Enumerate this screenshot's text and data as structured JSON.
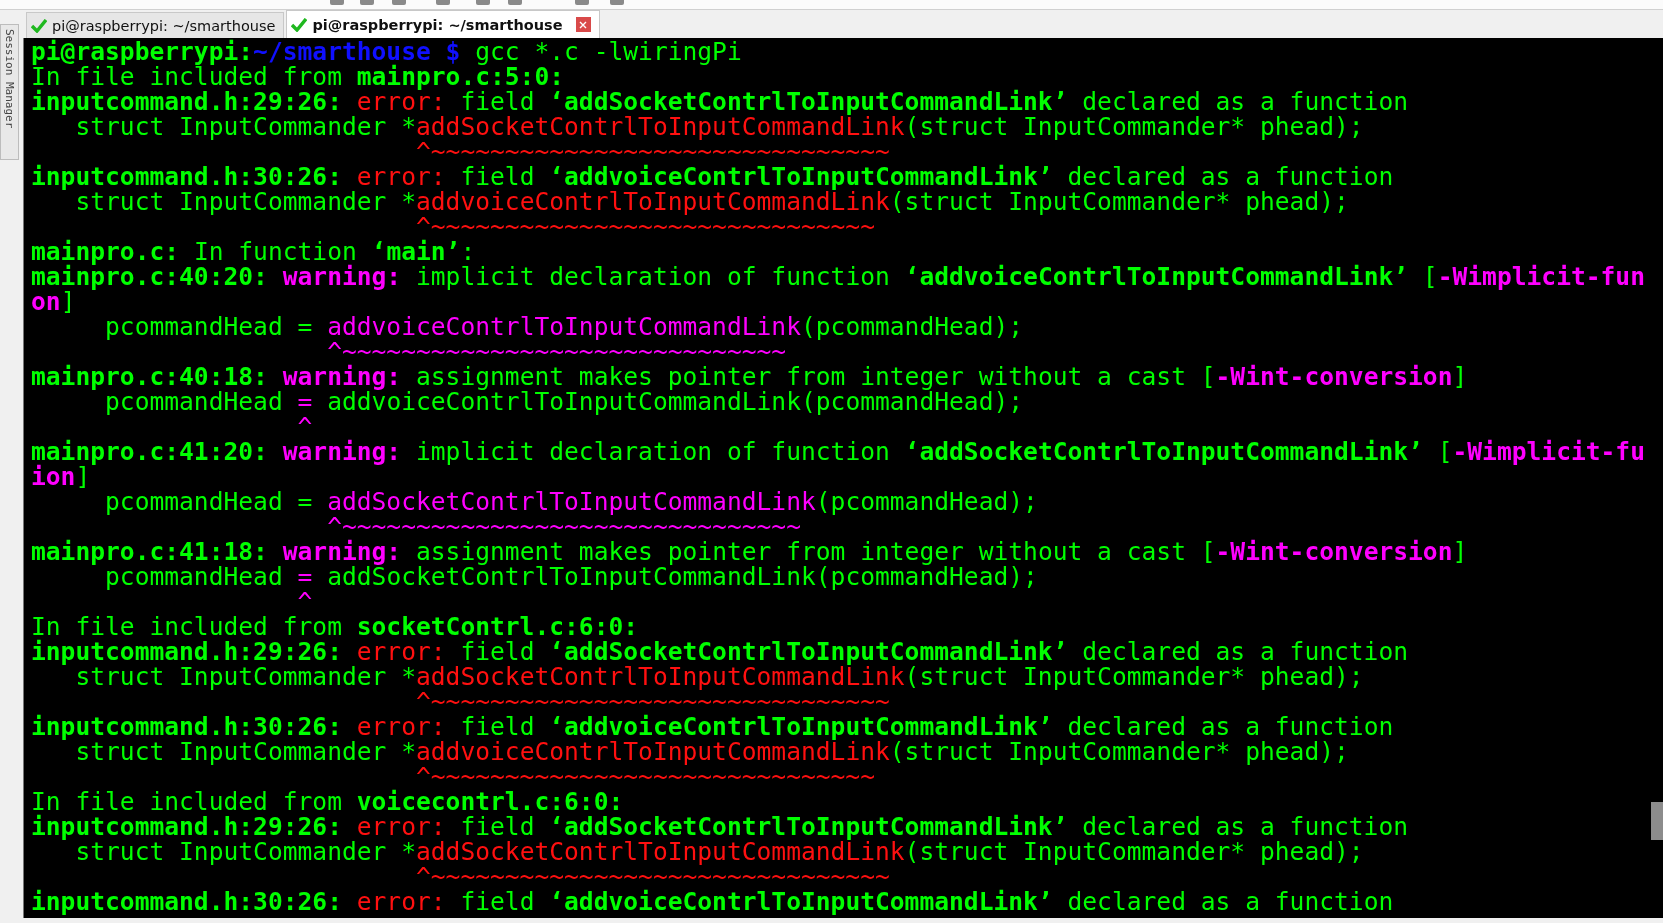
{
  "side_panel": {
    "label": "Session Manager"
  },
  "tabs": [
    {
      "label": "pi@raspberrypi: ~/smarthouse",
      "selected": false,
      "connected": true
    },
    {
      "label": "pi@raspberrypi: ~/smarthouse",
      "selected": true,
      "connected": true
    }
  ],
  "terminal": {
    "lines": [
      [
        {
          "kind": "prompt",
          "text": "pi@raspberrypi:"
        },
        {
          "kind": "path",
          "text": "~/smarthouse $"
        },
        {
          "kind": "plain",
          "text": " gcc *.c -lwiringPi"
        }
      ],
      [
        {
          "kind": "plain",
          "text": "In file included from "
        },
        {
          "kind": "bold",
          "text": "mainpro.c:5:0:"
        }
      ],
      [
        {
          "kind": "bold",
          "text": "inputcommand.h:29:26: "
        },
        {
          "kind": "error",
          "text": "error:"
        },
        {
          "kind": "plain",
          "text": " field "
        },
        {
          "kind": "bold",
          "text": "‘addSocketContrlToInputCommandLink’"
        },
        {
          "kind": "plain",
          "text": " declared as a function"
        }
      ],
      [
        {
          "kind": "plain",
          "text": "   struct InputCommander *"
        },
        {
          "kind": "error",
          "text": "addSocketContrlToInputCommandLink"
        },
        {
          "kind": "plain",
          "text": "(struct InputCommander* phead);"
        }
      ],
      [
        {
          "kind": "error",
          "text": "                          ^~~~~~~~~~~~~~~~~~~~~~~~~~~~~~~~"
        }
      ],
      [
        {
          "kind": "bold",
          "text": "inputcommand.h:30:26: "
        },
        {
          "kind": "error",
          "text": "error:"
        },
        {
          "kind": "plain",
          "text": " field "
        },
        {
          "kind": "bold",
          "text": "‘addvoiceContrlToInputCommandLink’"
        },
        {
          "kind": "plain",
          "text": " declared as a function"
        }
      ],
      [
        {
          "kind": "plain",
          "text": "   struct InputCommander *"
        },
        {
          "kind": "error",
          "text": "addvoiceContrlToInputCommandLink"
        },
        {
          "kind": "plain",
          "text": "(struct InputCommander* phead);"
        }
      ],
      [
        {
          "kind": "error",
          "text": "                          ^~~~~~~~~~~~~~~~~~~~~~~~~~~~~~~"
        }
      ],
      [
        {
          "kind": "bold",
          "text": "mainpro.c:"
        },
        {
          "kind": "plain",
          "text": " In function "
        },
        {
          "kind": "bold",
          "text": "‘main’"
        },
        {
          "kind": "plain",
          "text": ":"
        }
      ],
      [
        {
          "kind": "bold",
          "text": "mainpro.c:40:20: "
        },
        {
          "kind": "warning",
          "text": "warning:"
        },
        {
          "kind": "plain",
          "text": " implicit declaration of function "
        },
        {
          "kind": "bold",
          "text": "‘addvoiceContrlToInputCommandLink’"
        },
        {
          "kind": "plain",
          "text": " ["
        },
        {
          "kind": "warning",
          "text": "-Wimplicit-fun"
        }
      ],
      [
        {
          "kind": "warning",
          "text": "on"
        },
        {
          "kind": "plain",
          "text": "]"
        }
      ],
      [
        {
          "kind": "plain",
          "text": "     pcommandHead = "
        },
        {
          "kind": "highlight",
          "text": "addvoiceContrlToInputCommandLink"
        },
        {
          "kind": "plain",
          "text": "(pcommandHead);"
        }
      ],
      [
        {
          "kind": "highlight",
          "text": "                    ^~~~~~~~~~~~~~~~~~~~~~~~~~~~~~~"
        }
      ],
      [
        {
          "kind": "bold",
          "text": "mainpro.c:40:18: "
        },
        {
          "kind": "warning",
          "text": "warning:"
        },
        {
          "kind": "plain",
          "text": " assignment makes pointer from integer without a cast ["
        },
        {
          "kind": "warning",
          "text": "-Wint-conversion"
        },
        {
          "kind": "plain",
          "text": "]"
        }
      ],
      [
        {
          "kind": "plain",
          "text": "     pcommandHead "
        },
        {
          "kind": "highlight",
          "text": "="
        },
        {
          "kind": "plain",
          "text": " addvoiceContrlToInputCommandLink(pcommandHead);"
        }
      ],
      [
        {
          "kind": "highlight",
          "text": "                  ^"
        }
      ],
      [
        {
          "kind": "bold",
          "text": "mainpro.c:41:20: "
        },
        {
          "kind": "warning",
          "text": "warning:"
        },
        {
          "kind": "plain",
          "text": " implicit declaration of function "
        },
        {
          "kind": "bold",
          "text": "‘addSocketContrlToInputCommandLink’"
        },
        {
          "kind": "plain",
          "text": " ["
        },
        {
          "kind": "warning",
          "text": "-Wimplicit-fu"
        }
      ],
      [
        {
          "kind": "warning",
          "text": "ion"
        },
        {
          "kind": "plain",
          "text": "]"
        }
      ],
      [
        {
          "kind": "plain",
          "text": "     pcommandHead = "
        },
        {
          "kind": "highlight",
          "text": "addSocketContrlToInputCommandLink"
        },
        {
          "kind": "plain",
          "text": "(pcommandHead);"
        }
      ],
      [
        {
          "kind": "highlight",
          "text": "                    ^~~~~~~~~~~~~~~~~~~~~~~~~~~~~~~~"
        }
      ],
      [
        {
          "kind": "bold",
          "text": "mainpro.c:41:18: "
        },
        {
          "kind": "warning",
          "text": "warning:"
        },
        {
          "kind": "plain",
          "text": " assignment makes pointer from integer without a cast ["
        },
        {
          "kind": "warning",
          "text": "-Wint-conversion"
        },
        {
          "kind": "plain",
          "text": "]"
        }
      ],
      [
        {
          "kind": "plain",
          "text": "     pcommandHead "
        },
        {
          "kind": "highlight",
          "text": "="
        },
        {
          "kind": "plain",
          "text": " addSocketContrlToInputCommandLink(pcommandHead);"
        }
      ],
      [
        {
          "kind": "highlight",
          "text": "                  ^"
        }
      ],
      [
        {
          "kind": "plain",
          "text": "In file included from "
        },
        {
          "kind": "bold",
          "text": "socketContrl.c:6:0:"
        }
      ],
      [
        {
          "kind": "bold",
          "text": "inputcommand.h:29:26: "
        },
        {
          "kind": "error",
          "text": "error:"
        },
        {
          "kind": "plain",
          "text": " field "
        },
        {
          "kind": "bold",
          "text": "‘addSocketContrlToInputCommandLink’"
        },
        {
          "kind": "plain",
          "text": " declared as a function"
        }
      ],
      [
        {
          "kind": "plain",
          "text": "   struct InputCommander *"
        },
        {
          "kind": "error",
          "text": "addSocketContrlToInputCommandLink"
        },
        {
          "kind": "plain",
          "text": "(struct InputCommander* phead);"
        }
      ],
      [
        {
          "kind": "error",
          "text": "                          ^~~~~~~~~~~~~~~~~~~~~~~~~~~~~~~~"
        }
      ],
      [
        {
          "kind": "bold",
          "text": "inputcommand.h:30:26: "
        },
        {
          "kind": "error",
          "text": "error:"
        },
        {
          "kind": "plain",
          "text": " field "
        },
        {
          "kind": "bold",
          "text": "‘addvoiceContrlToInputCommandLink’"
        },
        {
          "kind": "plain",
          "text": " declared as a function"
        }
      ],
      [
        {
          "kind": "plain",
          "text": "   struct InputCommander *"
        },
        {
          "kind": "error",
          "text": "addvoiceContrlToInputCommandLink"
        },
        {
          "kind": "plain",
          "text": "(struct InputCommander* phead);"
        }
      ],
      [
        {
          "kind": "error",
          "text": "                          ^~~~~~~~~~~~~~~~~~~~~~~~~~~~~~~"
        }
      ],
      [
        {
          "kind": "plain",
          "text": "In file included from "
        },
        {
          "kind": "bold",
          "text": "voicecontrl.c:6:0:"
        }
      ],
      [
        {
          "kind": "bold",
          "text": "inputcommand.h:29:26: "
        },
        {
          "kind": "error",
          "text": "error:"
        },
        {
          "kind": "plain",
          "text": " field "
        },
        {
          "kind": "bold",
          "text": "‘addSocketContrlToInputCommandLink’"
        },
        {
          "kind": "plain",
          "text": " declared as a function"
        }
      ],
      [
        {
          "kind": "plain",
          "text": "   struct InputCommander *"
        },
        {
          "kind": "error",
          "text": "addSocketContrlToInputCommandLink"
        },
        {
          "kind": "plain",
          "text": "(struct InputCommander* phead);"
        }
      ],
      [
        {
          "kind": "error",
          "text": "                          ^~~~~~~~~~~~~~~~~~~~~~~~~~~~~~~~"
        }
      ],
      [
        {
          "kind": "bold",
          "text": "inputcommand.h:30:26: "
        },
        {
          "kind": "error",
          "text": "error:"
        },
        {
          "kind": "plain",
          "text": " field "
        },
        {
          "kind": "bold",
          "text": "‘addvoiceContrlToInputCommandLink’"
        },
        {
          "kind": "plain",
          "text": " declared as a function"
        }
      ]
    ]
  }
}
